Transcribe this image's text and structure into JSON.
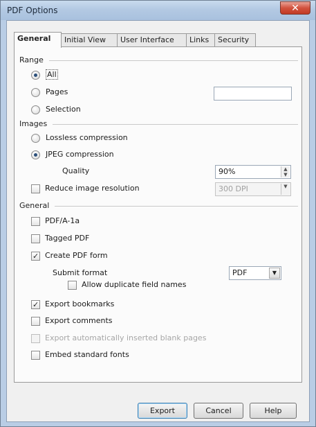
{
  "window": {
    "title": "PDF Options",
    "close_symbol": "✕"
  },
  "tabs": [
    {
      "label": "General",
      "active": true
    },
    {
      "label": "Initial View",
      "active": false
    },
    {
      "label": "User Interface",
      "active": false
    },
    {
      "label": "Links",
      "active": false
    },
    {
      "label": "Security",
      "active": false
    }
  ],
  "range": {
    "heading": "Range",
    "all": {
      "label": "All",
      "selected": true
    },
    "pages": {
      "label": "Pages",
      "selected": false,
      "value": ""
    },
    "selection": {
      "label": "Selection",
      "selected": false
    }
  },
  "images": {
    "heading": "Images",
    "lossless": {
      "label": "Lossless compression",
      "selected": false
    },
    "jpeg": {
      "label": "JPEG compression",
      "selected": true
    },
    "quality": {
      "label": "Quality",
      "value": "90%"
    },
    "reduce": {
      "label": "Reduce image resolution",
      "checked": false,
      "value": "300 DPI"
    }
  },
  "general": {
    "heading": "General",
    "pdfa": {
      "label": "PDF/A-1a",
      "checked": false
    },
    "tagged": {
      "label": "Tagged PDF",
      "checked": false
    },
    "create_form": {
      "label": "Create PDF form",
      "checked": true
    },
    "submit_format": {
      "label": "Submit format",
      "value": "PDF"
    },
    "allow_duplicate": {
      "label": "Allow duplicate field names",
      "checked": false
    },
    "export_bookmarks": {
      "label": "Export bookmarks",
      "checked": true
    },
    "export_comments": {
      "label": "Export comments",
      "checked": false
    },
    "export_blank": {
      "label": "Export automatically inserted blank pages",
      "checked": false,
      "enabled": false
    },
    "embed_fonts": {
      "label": "Embed standard fonts",
      "checked": false
    }
  },
  "buttons": {
    "export": "Export",
    "cancel": "Cancel",
    "help": "Help"
  }
}
